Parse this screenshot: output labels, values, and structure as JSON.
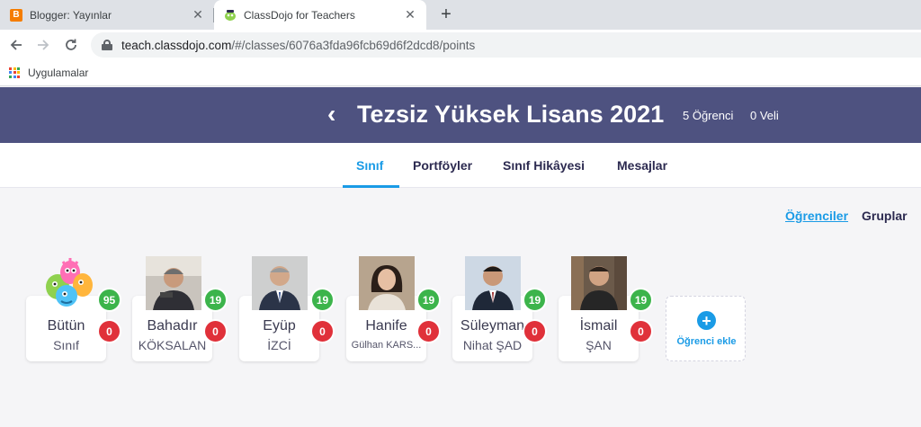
{
  "browser": {
    "tabs": [
      {
        "title": "Blogger: Yayınlar",
        "favicon": "blogger-icon",
        "active": false
      },
      {
        "title": "ClassDojo for Teachers",
        "favicon": "classdojo-icon",
        "active": true
      }
    ],
    "url_host": "teach.classdojo.com",
    "url_path": "/#/classes/6076a3fda96fcb69d6f2dcd8/points",
    "bookmarks_label": "Uygulamalar"
  },
  "header": {
    "class_name": "Tezsiz Yüksek Lisans 2021",
    "students_count": "5 Öğrenci",
    "parents_count": "0 Veli"
  },
  "nav": {
    "tabs": [
      "Sınıf",
      "Portföyler",
      "Sınıf Hikâyesi",
      "Mesajlar"
    ],
    "active": "Sınıf"
  },
  "view_toggle": {
    "students": "Öğrenciler",
    "groups": "Gruplar"
  },
  "students": [
    {
      "first": "Bütün",
      "last": "Sınıf",
      "positive": "95",
      "negative": "0",
      "avatar": "monsters-illustration"
    },
    {
      "first": "Bahadır",
      "last": "KÖKSALAN",
      "positive": "19",
      "negative": "0",
      "avatar": "photo"
    },
    {
      "first": "Eyüp",
      "last": "İZCİ",
      "positive": "19",
      "negative": "0",
      "avatar": "photo"
    },
    {
      "first": "Hanife",
      "last": "Gülhan KARS...",
      "positive": "19",
      "negative": "0",
      "avatar": "photo"
    },
    {
      "first": "Süleyman",
      "last": "Nihat ŞAD",
      "positive": "19",
      "negative": "0",
      "avatar": "photo"
    },
    {
      "first": "İsmail",
      "last": "ŞAN",
      "positive": "19",
      "negative": "0",
      "avatar": "photo"
    }
  ],
  "add_student_label": "Öğrenci ekle",
  "colors": {
    "header_bg": "#4e5280",
    "accent": "#1a9be6",
    "positive": "#3cb44b",
    "negative": "#e0313a"
  }
}
